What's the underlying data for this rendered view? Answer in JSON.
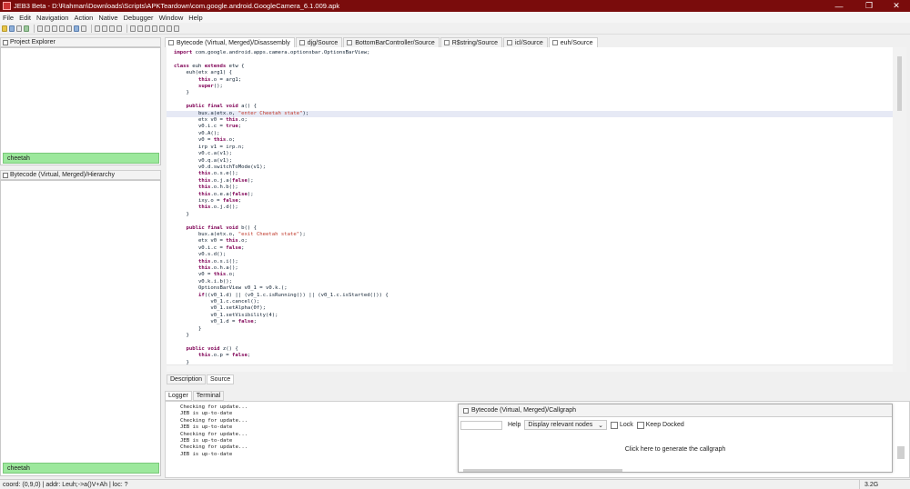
{
  "window": {
    "title": "JEB3 Beta - D:\\Rahman\\Downloads\\Scripts\\APKTeardown\\com.google.android.GoogleCamera_6.1.009.apk",
    "minimize": "—",
    "maximize": "❐",
    "close": "✕"
  },
  "menu": [
    "File",
    "Edit",
    "Navigation",
    "Action",
    "Native",
    "Debugger",
    "Window",
    "Help"
  ],
  "project_explorer": {
    "title": "Project Explorer",
    "filter_value": "cheetah"
  },
  "hierarchy": {
    "title": "Bytecode (Virtual, Merged)/Hierarchy",
    "filter_value": "cheetah"
  },
  "editor_tabs": [
    "Bytecode (Virtual, Merged)/Disassembly",
    "djg/Source",
    "BottomBarController/Source",
    "R$string/Source",
    "icl/Source",
    "euh/Source"
  ],
  "code_lines": [
    "import com.google.android.apps.camera.optionsbar.OptionsBarView;",
    "",
    "class euh extends etw {",
    "    euh(etx arg1) {",
    "        this.o = arg1;",
    "        super();",
    "    }",
    "",
    "    public final void a() {",
    "        bux.a(etx.o, \"enter Cheetah state\");",
    "        etx v0 = this.o;",
    "        v0.i.c = true;",
    "        v0.A();",
    "        v0 = this.o;",
    "        irp v1 = irp.n;",
    "        v0.c.a(v1);",
    "        v0.q.a(v1);",
    "        v0.d.switchToMode(v1);",
    "        this.o.s.e();",
    "        this.o.j.a(false);",
    "        this.o.h.b();",
    "        this.o.e.a(false);",
    "        ixy.o = false;",
    "        this.o.j.d();",
    "    }",
    "",
    "    public final void b() {",
    "        bux.a(etx.o, \"exit Cheetah state\");",
    "        etx v0 = this.o;",
    "        v0.i.c = false;",
    "        v0.s.d();",
    "        this.o.s.i();",
    "        this.o.h.a();",
    "        v0 = this.o;",
    "        v0.k.i.b();",
    "        OptionsBarView v0_1 = v0.k.(;",
    "        if((v0_1.d) || (v0_1.c.isRunning()) || (v0_1.c.isStarted())) {",
    "            v0_1.c.cancel();",
    "            v0_1.setAlpha(0f);",
    "            v0_1.setVisibility(4);",
    "            v0_1.d = false;",
    "        }",
    "    }",
    "",
    "    public void z() {",
    "        this.o.p = false;",
    "    }"
  ],
  "bottom_tabs": [
    "Description",
    "Source"
  ],
  "console_tabs": [
    "Logger",
    "Terminal"
  ],
  "console_lines": [
    "Checking for update...",
    "JEB is up-to-date",
    "Checking for update...",
    "JEB is up-to-date",
    "Checking for update...",
    "JEB is up-to-date",
    "Checking for update...",
    "JEB is up-to-date"
  ],
  "callgraph": {
    "title": "Bytecode (Virtual, Merged)/Callgraph",
    "help": "Help",
    "display_select": "Display relevant nodes",
    "lock_label": "Lock",
    "keep_docked_label": "Keep Docked",
    "generate_text": "Click here to generate the callgraph"
  },
  "status": {
    "text": "coord: (0,9,0) | addr: Leuh;->a()V+Ah | loc: ?",
    "memory": "3.2G"
  }
}
